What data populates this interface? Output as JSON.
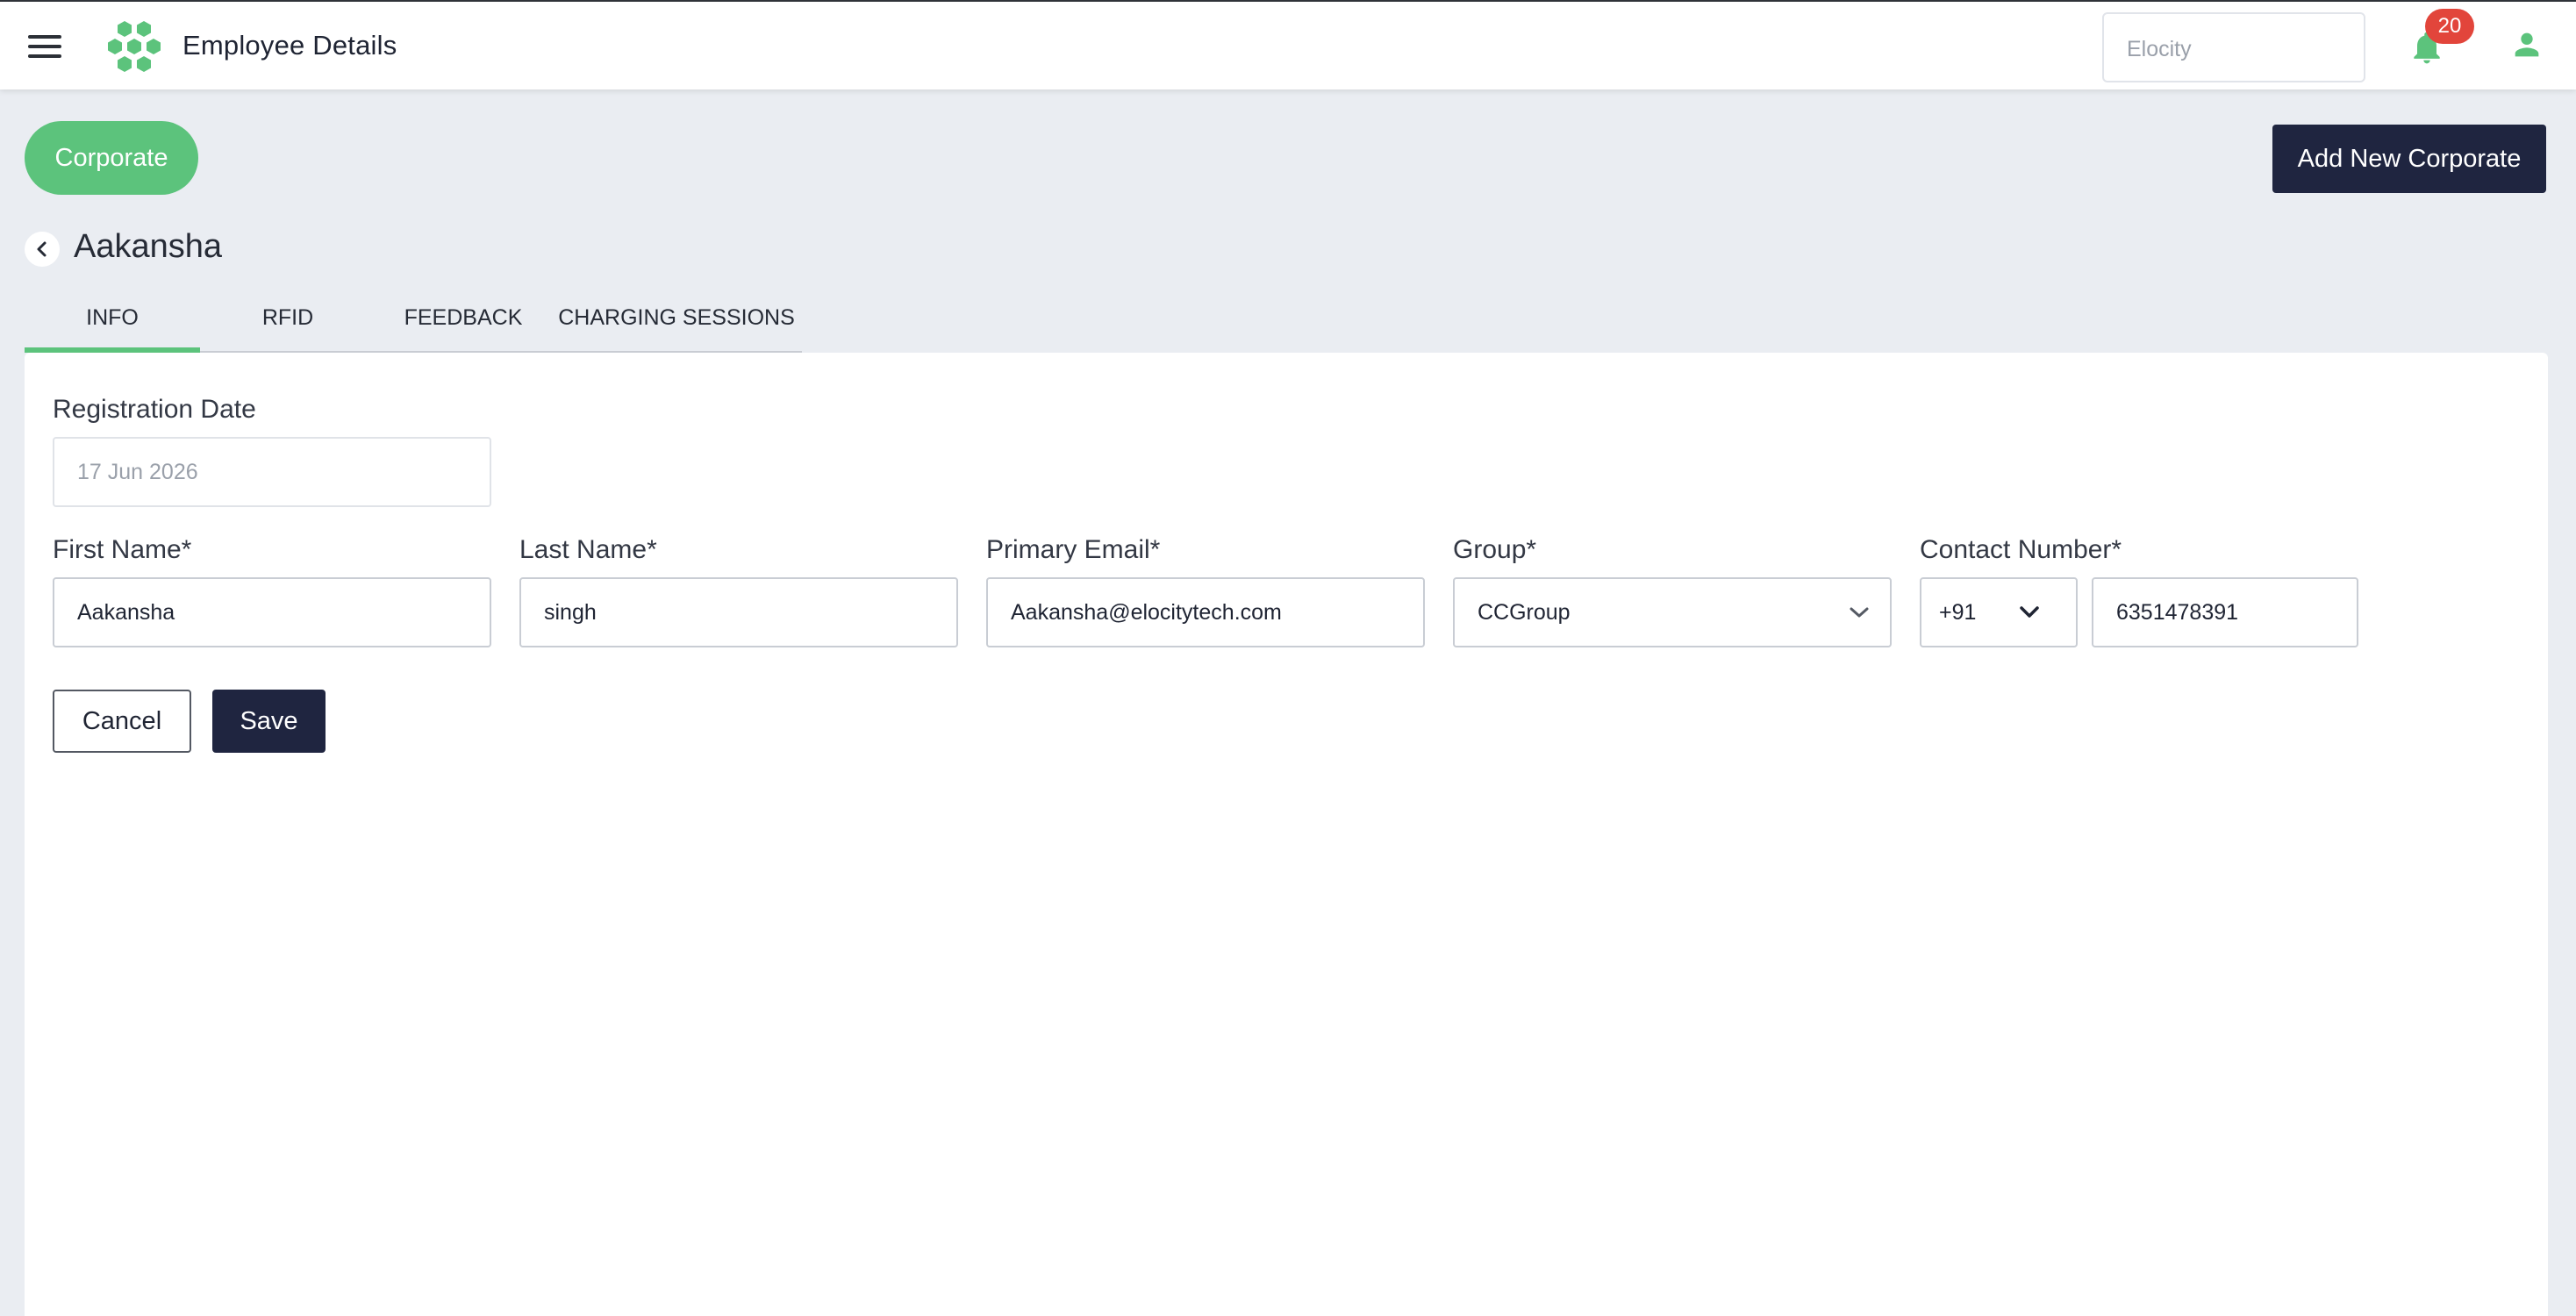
{
  "header": {
    "title": "Employee Details",
    "tenant_placeholder": "Elocity",
    "notification_count": "20",
    "menu_icon": "hamburger-menu-icon",
    "logo_icon": "hexagon-cluster-logo",
    "bell_icon": "bell-icon",
    "user_icon": "user-icon"
  },
  "corporate": {
    "pill_label": "Corporate",
    "add_button_label": "Add New Corporate"
  },
  "employee": {
    "name": "Aakansha"
  },
  "tabs": [
    {
      "label": "INFO",
      "active": true
    },
    {
      "label": "RFID",
      "active": false
    },
    {
      "label": "FEEDBACK",
      "active": false
    },
    {
      "label": "CHARGING SESSIONS",
      "active": false
    }
  ],
  "form": {
    "registration_date": {
      "label": "Registration Date",
      "value": "17 Jun 2026"
    },
    "first_name": {
      "label": "First Name*",
      "value": "Aakansha"
    },
    "last_name": {
      "label": "Last Name*",
      "value": "singh"
    },
    "primary_email": {
      "label": "Primary Email*",
      "value": "Aakansha@elocitytech.com"
    },
    "group": {
      "label": "Group*",
      "value": "CCGroup"
    },
    "contact_number": {
      "label": "Contact Number*",
      "country_code": "+91",
      "value": "6351478391"
    },
    "cancel_label": "Cancel",
    "save_label": "Save"
  },
  "colors": {
    "accent_green": "#5cc37c",
    "navy": "#1f2540",
    "badge_red": "#e2453b",
    "background": "#eaedf2"
  }
}
